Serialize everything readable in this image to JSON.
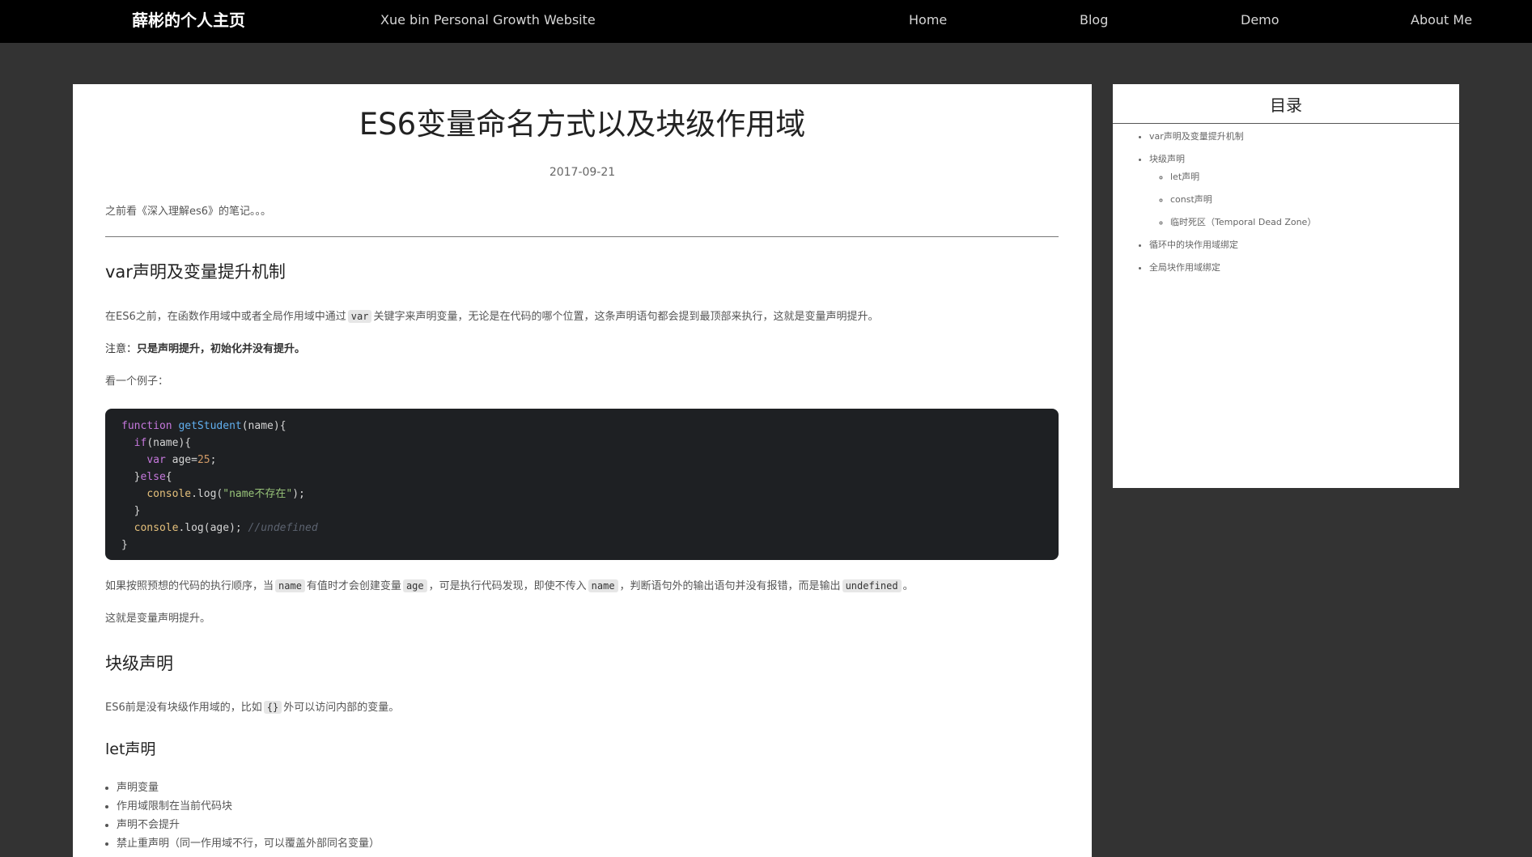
{
  "navbar": {
    "brand": "薛彬的个人主页",
    "tagline": "Xue bin Personal Growth Website",
    "links": [
      "Home",
      "Blog",
      "Demo",
      "About Me"
    ]
  },
  "article": {
    "title": "ES6变量命名方式以及块级作用域",
    "date": "2017-09-21",
    "intro": "之前看《深入理解es6》的笔记。。。",
    "sec1": {
      "heading": "var声明及变量提升机制",
      "p1_a": "在ES6之前，在函数作用域中或者全局作用域中通过",
      "p1_code": "var",
      "p1_b": "关键字来声明变量，无论是在代码的哪个位置，这条声明语句都会提到最顶部来执行，这就是变量声明提升。",
      "note_prefix": "注意：",
      "note_strong": "只是声明提升，初始化并没有提升。",
      "example": "看一个例子：",
      "code": {
        "l1_kw": "function",
        "l1_fn": "getStudent",
        "l1_rest": "(name){",
        "l2_kw": "if",
        "l2_rest": "(name){",
        "l3_kw": "var",
        "l3_mid": " age=",
        "l3_num": "25",
        "l3_end": ";",
        "l4_close": "}",
        "l4_kw": "else",
        "l4_rest": "{",
        "l5_obj": "console",
        "l5_mid": ".log(",
        "l5_str": "\"name不存在\"",
        "l5_end": ");",
        "l6": "}",
        "l7_obj": "console",
        "l7_mid": ".log(age); ",
        "l7_cm": "//undefined",
        "l8": "}"
      },
      "p2_a": "如果按照预想的代码的执行顺序，当",
      "p2_c1": "name",
      "p2_b": "有值时才会创建变量",
      "p2_c2": "age",
      "p2_c": "，可是执行代码发现，即使不传入",
      "p2_c3": "name",
      "p2_d": "，判断语句外的输出语句并没有报错，而是输出",
      "p2_c4": "undefined",
      "p2_e": "。",
      "p3": "这就是变量声明提升。"
    },
    "sec2": {
      "heading": "块级声明",
      "p1_a": "ES6前是没有块级作用域的，比如",
      "p1_code": "{}",
      "p1_b": "外可以访问内部的变量。",
      "sub_heading": "let声明",
      "bullets": [
        "声明变量",
        "作用域限制在当前代码块",
        "声明不会提升",
        "禁止重声明（同一作用域不行，可以覆盖外部同名变量）"
      ]
    }
  },
  "toc": {
    "title": "目录",
    "items": [
      "var声明及变量提升机制",
      "块级声明",
      "循环中的块作用域绑定",
      "全局块作用域绑定"
    ],
    "sub_items": [
      "let声明",
      "const声明",
      "临时死区（Temporal Dead Zone）"
    ]
  }
}
